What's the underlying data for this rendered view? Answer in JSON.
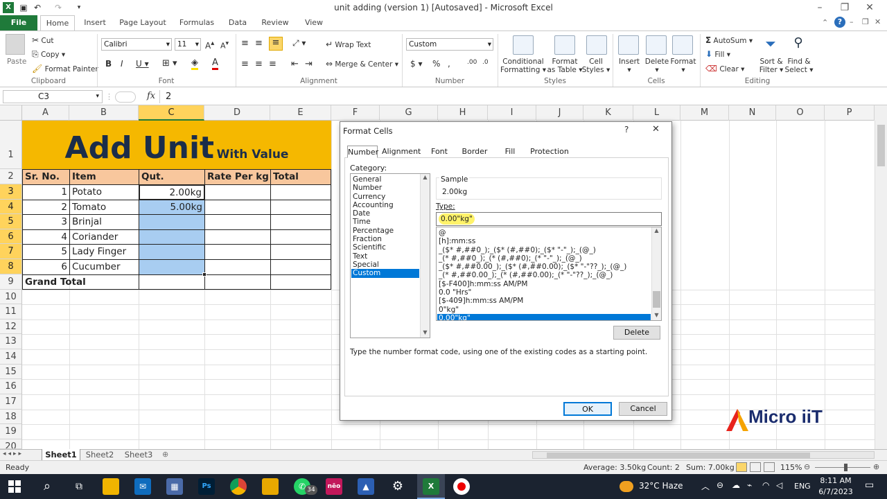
{
  "window": {
    "title": "unit adding (version 1) [Autosaved] - Microsoft Excel"
  },
  "tabs": [
    "File",
    "Home",
    "Insert",
    "Page Layout",
    "Formulas",
    "Data",
    "Review",
    "View"
  ],
  "ribbon": {
    "clipboard": {
      "paste": "Paste",
      "cut": "Cut",
      "copy": "Copy",
      "format_painter": "Format Painter",
      "label": "Clipboard"
    },
    "font": {
      "name": "Calibri",
      "size": "11",
      "label": "Font"
    },
    "alignment": {
      "wrap": "Wrap Text",
      "merge": "Merge & Center",
      "label": "Alignment"
    },
    "number": {
      "format": "Custom",
      "label": "Number"
    },
    "styles": {
      "conditional": "Conditional Formatting",
      "conditional_a": "Conditional",
      "conditional_b": "Formatting",
      "table_a": "Format",
      "table_b": "as Table",
      "cell_a": "Cell",
      "cell_b": "Styles",
      "label": "Styles"
    },
    "cells": {
      "insert": "Insert",
      "delete": "Delete",
      "format": "Format",
      "label": "Cells"
    },
    "editing": {
      "autosum": "AutoSum",
      "fill": "Fill",
      "clear": "Clear",
      "sort_a": "Sort &",
      "sort_b": "Filter",
      "find_a": "Find &",
      "find_b": "Select",
      "label": "Editing"
    }
  },
  "formula_bar": {
    "name_box": "C3",
    "fx": "fx",
    "formula": "2"
  },
  "columns": [
    "A",
    "B",
    "C",
    "D",
    "E",
    "F",
    "G",
    "H",
    "I",
    "J",
    "K",
    "L",
    "M",
    "N",
    "O",
    "P"
  ],
  "rows": [
    "1",
    "2",
    "3",
    "4",
    "5",
    "6",
    "7",
    "8",
    "9",
    "10",
    "11",
    "12",
    "13",
    "14",
    "15",
    "16",
    "17",
    "18",
    "19",
    "20"
  ],
  "sheet": {
    "title_main": "Add Unit",
    "title_sub": "With Value",
    "headers": [
      "Sr. No.",
      "Item",
      "Qut.",
      "Rate Per kg",
      "Total"
    ],
    "data": [
      {
        "sr": "1",
        "item": "Potato",
        "qty": "2.00kg"
      },
      {
        "sr": "2",
        "item": "Tomato",
        "qty": "5.00kg"
      },
      {
        "sr": "3",
        "item": "Brinjal",
        "qty": ""
      },
      {
        "sr": "4",
        "item": "Coriander",
        "qty": ""
      },
      {
        "sr": "5",
        "item": "Lady Finger",
        "qty": ""
      },
      {
        "sr": "6",
        "item": "Cucumber",
        "qty": ""
      }
    ],
    "grand_total": "Grand Total"
  },
  "sheet_tabs": [
    "Sheet1",
    "Sheet2",
    "Sheet3"
  ],
  "status": {
    "ready": "Ready",
    "average": "Average: 3.50kg",
    "count": "Count: 2",
    "sum": "Sum: 7.00kg",
    "zoom": "115%"
  },
  "dialog": {
    "title": "Format Cells",
    "help": "?",
    "close": "✕",
    "tabs": [
      "Number",
      "Alignment",
      "Font",
      "Border",
      "Fill",
      "Protection"
    ],
    "category_label": "Category:",
    "categories": [
      "General",
      "Number",
      "Currency",
      "Accounting",
      "Date",
      "Time",
      "Percentage",
      "Fraction",
      "Scientific",
      "Text",
      "Special",
      "Custom"
    ],
    "selected_category": "Custom",
    "sample_label": "Sample",
    "sample_value": "2.00kg",
    "type_label": "Type:",
    "type_value": "0.00\"kg\"",
    "formats": [
      "@",
      "[h]:mm:ss",
      "_($* #,##0_);_($* (#,##0);_($* \"-\"_);_(@_)",
      "_(* #,##0_);_(* (#,##0);_(* \"-\"_);_(@_)",
      "_($* #,##0.00_);_($* (#,##0.00);_($* \"-\"??_);_(@_)",
      "_(* #,##0.00_);_(* (#,##0.00);_(* \"-\"??_);_(@_)",
      "[$-F400]h:mm:ss AM/PM",
      "0.0 \"Hrs\"",
      "[$-409]h:mm:ss AM/PM",
      "0\"kg\"",
      "0.00\"kg\""
    ],
    "selected_format": "0.00\"kg\"",
    "delete": "Delete",
    "hint": "Type the number format code, using one of the existing codes as a starting point.",
    "ok": "OK",
    "cancel": "Cancel"
  },
  "watermark": {
    "brand": "Micro iiT"
  },
  "taskbar": {
    "weather": "32°C  Haze",
    "lang": "ENG",
    "time": "8:11 AM",
    "date": "6/7/2023",
    "badge": "34"
  },
  "colors": {
    "excel_green": "#1f7a3a",
    "title_fill": "#f5b800",
    "header_fill": "#f8c79d",
    "select_fill": "#a8cdf1",
    "dialog_sel": "#0078d7"
  }
}
